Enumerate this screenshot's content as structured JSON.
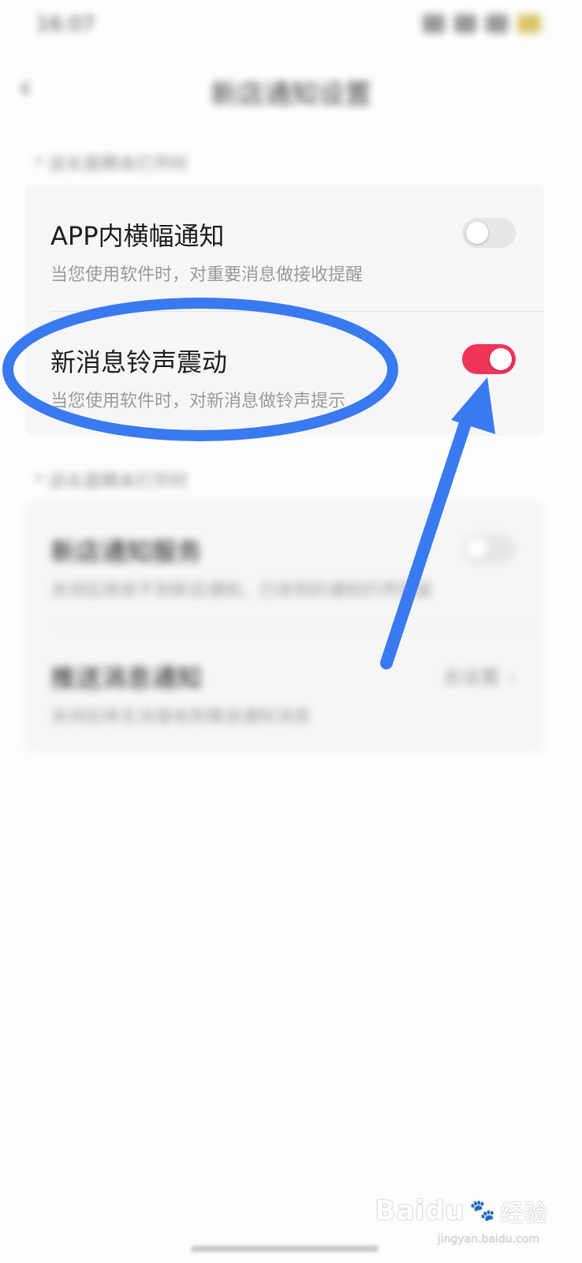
{
  "status_bar": {
    "time": "16:07"
  },
  "nav": {
    "back_icon": "‹",
    "title": "新店通知设置"
  },
  "section1": {
    "label": "* 店长直聘未打开时",
    "rows": [
      {
        "title": "APP内横幅通知",
        "desc": "当您使用软件时，对重要消息做接收提醒",
        "toggle": "off"
      },
      {
        "title": "新消息铃声震动",
        "desc": "当您使用软件时，对新消息做铃声提示",
        "toggle": "on"
      }
    ]
  },
  "section2": {
    "label": "* 店长直聘未打开时",
    "rows": [
      {
        "title": "新店通知服务",
        "desc": "关闭后将收不到新店通知，已收到的通知仍然保留",
        "toggle": "off"
      },
      {
        "title": "推送消息通知",
        "desc": "关闭后将无法接收到推送通知消息",
        "value": "去设置"
      }
    ]
  },
  "colors": {
    "toggle_on": "#f1345a",
    "toggle_off": "#e6e6e6",
    "annotation": "#3a7af0"
  },
  "watermark": {
    "logo": "Baidu",
    "cn": "经验",
    "url": "jingyan.baidu.com"
  }
}
